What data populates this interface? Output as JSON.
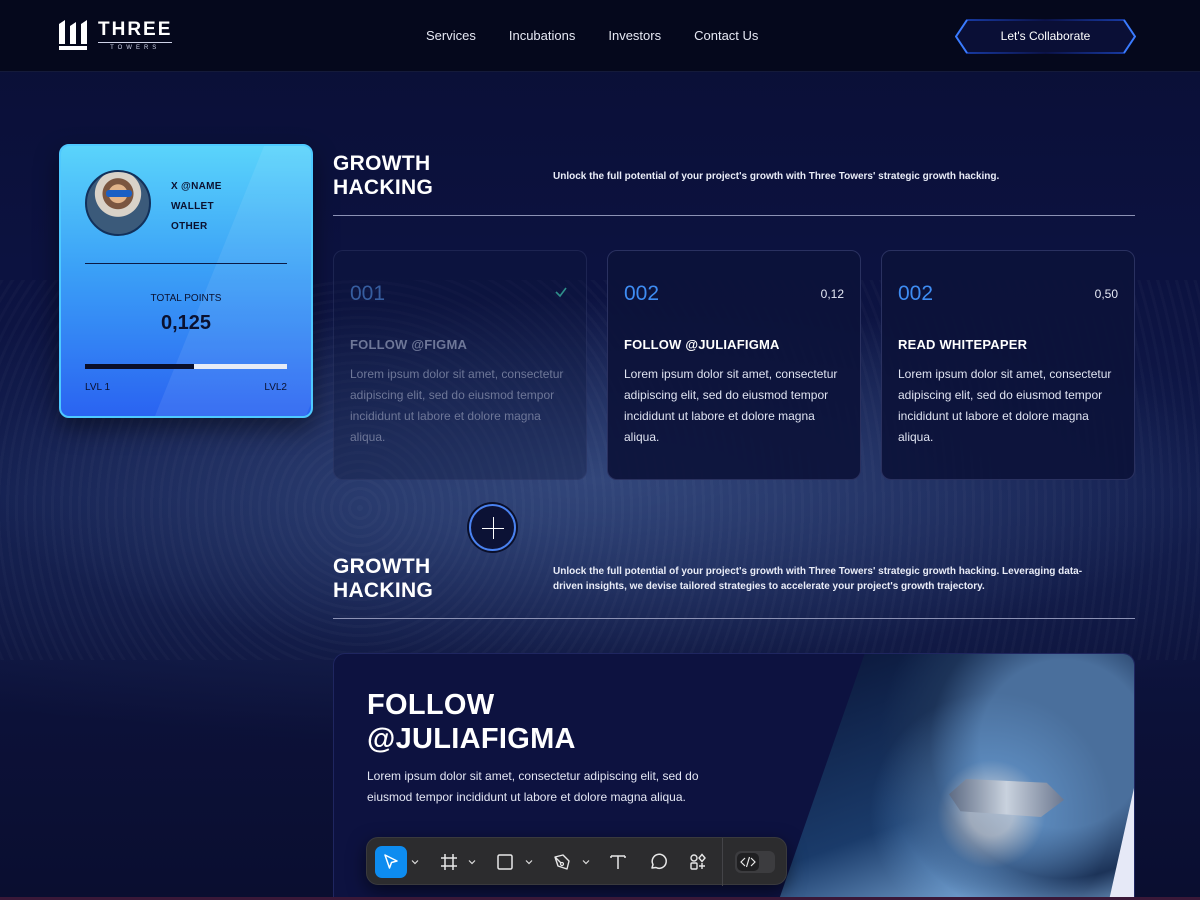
{
  "header": {
    "logo_main": "THREE",
    "logo_sub": "TOWERS",
    "nav": [
      "Services",
      "Incubations",
      "Investors",
      "Contact Us"
    ],
    "cta_label": "Let's Collaborate"
  },
  "profile": {
    "links": [
      "X @NAME",
      "WALLET",
      "OTHER"
    ],
    "total_points_label": "TOTAL POINTS",
    "total_points_value": "0,125",
    "progress": 0.54,
    "level_start": "LVL 1",
    "level_end": "LVL2"
  },
  "section1": {
    "title_line1": "GROWTH",
    "title_line2": "HACKING",
    "description": "Unlock the full potential of your project's growth with Three Towers' strategic growth hacking."
  },
  "tasks": [
    {
      "number": "001",
      "points": "",
      "completed": true,
      "title": "FOLLOW @FIGMA",
      "body": "Lorem ipsum dolor sit amet, consectetur adipiscing elit, sed do eiusmod tempor incididunt ut labore et dolore magna aliqua."
    },
    {
      "number": "002",
      "points": "0,12",
      "completed": false,
      "title": "FOLLOW @JULIAFIGMA",
      "body": "Lorem ipsum dolor sit amet, consectetur adipiscing elit, sed do eiusmod tempor incididunt ut labore et dolore magna aliqua."
    },
    {
      "number": "002",
      "points": "0,50",
      "completed": false,
      "title": "READ WHITEPAPER",
      "body": "Lorem ipsum dolor sit amet, consectetur adipiscing elit, sed do eiusmod tempor incididunt ut labore et dolore magna aliqua."
    }
  ],
  "section2": {
    "title_line1": "GROWTH",
    "title_line2": "HACKING",
    "description_line1": "Unlock the full potential of your project's growth with Three Towers' strategic growth hacking. Leveraging data-",
    "description_line2": "driven insights, we devise tailored strategies to accelerate your project's growth trajectory."
  },
  "feature": {
    "title_line1": "FOLLOW",
    "title_line2": "@JULIAFIGMA",
    "body": "Lorem ipsum dolor sit amet, consectetur adipiscing elit, sed do eiusmod tempor incididunt ut labore et dolore magna aliqua."
  },
  "toolbar": {
    "tools": [
      "move-tool",
      "frame-tool",
      "rectangle-tool",
      "pen-tool",
      "text-tool",
      "comment-tool",
      "actions-tool"
    ],
    "selected": "move-tool"
  },
  "colors": {
    "accent": "#3e8cf2",
    "profile_top": "#5ad4fb",
    "profile_bottom": "#2a63f1",
    "toolbar_selected": "#0d8cf0"
  }
}
